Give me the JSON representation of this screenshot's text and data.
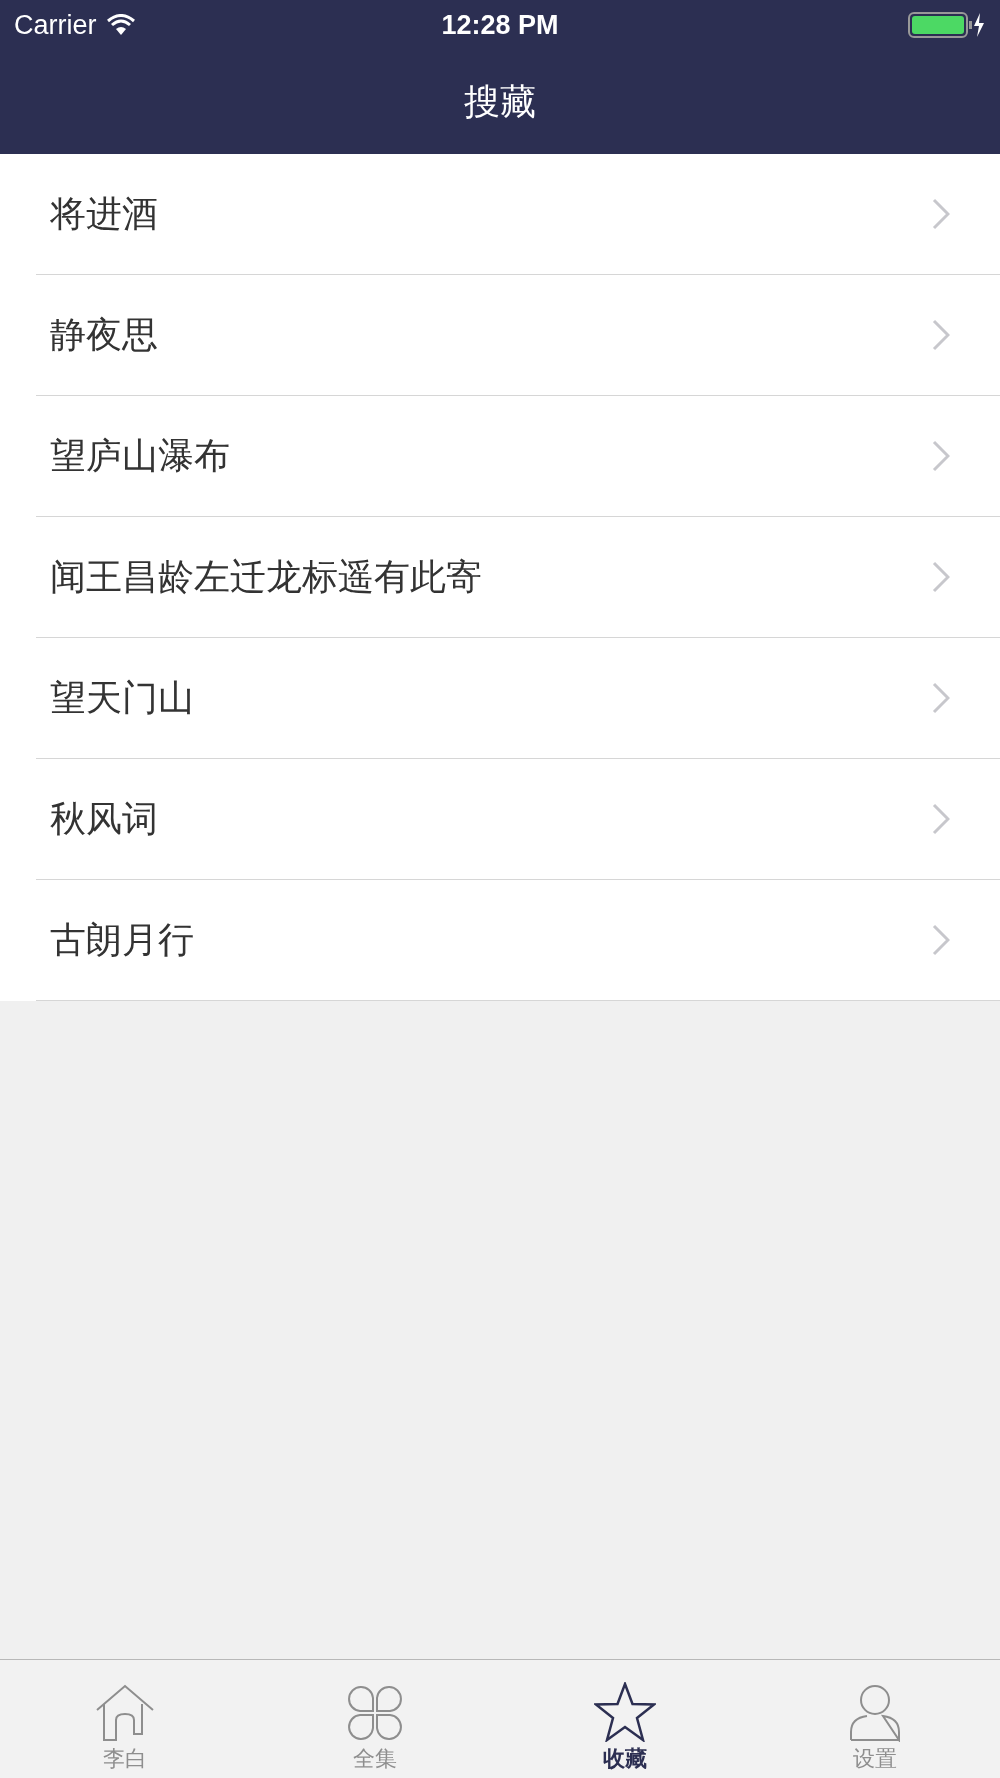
{
  "status_bar": {
    "carrier": "Carrier",
    "time": "12:28 PM"
  },
  "nav_bar": {
    "title": "搜藏"
  },
  "list": [
    {
      "title": "将进酒"
    },
    {
      "title": "静夜思"
    },
    {
      "title": "望庐山瀑布"
    },
    {
      "title": "闻王昌龄左迁龙标遥有此寄"
    },
    {
      "title": "望天门山"
    },
    {
      "title": "秋风词"
    },
    {
      "title": "古朗月行"
    }
  ],
  "tabs": [
    {
      "label": "李白",
      "kind": "home",
      "selected": false
    },
    {
      "label": "全集",
      "kind": "petals",
      "selected": false
    },
    {
      "label": "收藏",
      "kind": "star",
      "selected": true
    },
    {
      "label": "设置",
      "kind": "person",
      "selected": false
    }
  ]
}
